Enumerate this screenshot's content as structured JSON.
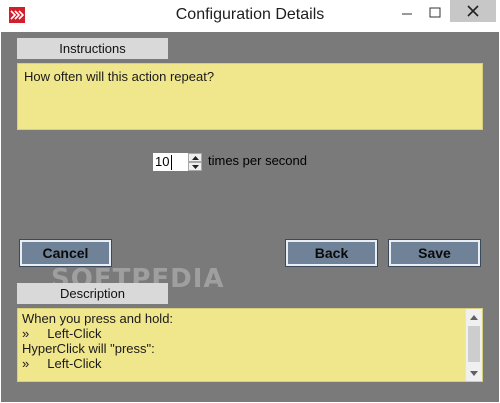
{
  "window": {
    "title": "Configuration Details"
  },
  "instructions": {
    "tab_label": "Instructions",
    "text": "How often will this action repeat?"
  },
  "repeat_rate": {
    "value": "10",
    "unit": "times per second"
  },
  "buttons": {
    "cancel": "Cancel",
    "back": "Back",
    "save": "Save"
  },
  "description": {
    "tab_label": "Description",
    "lines": [
      "When you press and hold:",
      "»     Left-Click",
      "HyperClick will \"press\":",
      "»     Left-Click"
    ]
  },
  "watermark": "SOFTPEDIA",
  "colors": {
    "panel_bg": "#7a7a7a",
    "note_bg": "#f0e68c",
    "tab_bg": "#d9d9d9",
    "button_bg": "#6f8298",
    "app_icon_red": "#d21f2b"
  }
}
